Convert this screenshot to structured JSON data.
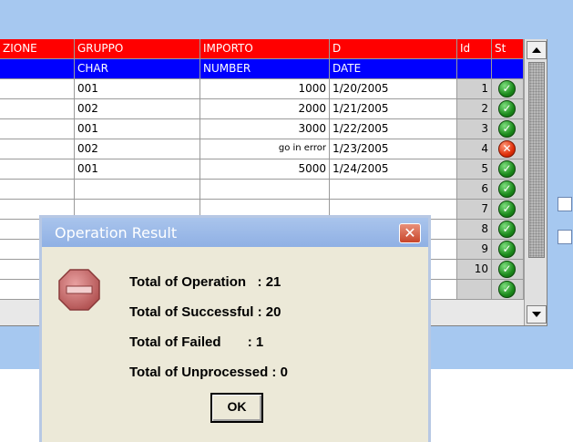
{
  "table": {
    "headers": [
      "ZIONE",
      "GRUPPO",
      "IMPORTO",
      "D",
      "Id",
      "St"
    ],
    "types": [
      "",
      "CHAR",
      "NUMBER",
      "DATE",
      "",
      ""
    ],
    "rows": [
      {
        "gruppo": "001",
        "importo": "1000",
        "date": "1/20/2005",
        "id": "1",
        "status": "success"
      },
      {
        "gruppo": "002",
        "importo": "2000",
        "date": "1/21/2005",
        "id": "2",
        "status": "success"
      },
      {
        "gruppo": "001",
        "importo": "3000",
        "date": "1/22/2005",
        "id": "3",
        "status": "success"
      },
      {
        "gruppo": "002",
        "importo": "go in error",
        "date": "1/23/2005",
        "id": "4",
        "status": "error"
      },
      {
        "gruppo": "001",
        "importo": "5000",
        "date": "1/24/2005",
        "id": "5",
        "status": "success"
      },
      {
        "gruppo": "",
        "importo": "",
        "date": "",
        "id": "6",
        "status": "success"
      },
      {
        "gruppo": "",
        "importo": "",
        "date": "",
        "id": "7",
        "status": "success"
      },
      {
        "gruppo": "",
        "importo": "",
        "date": "",
        "id": "8",
        "status": "success"
      },
      {
        "gruppo": "",
        "importo": "",
        "date": "",
        "id": "9",
        "status": "success"
      },
      {
        "gruppo": "",
        "importo": "",
        "date": "",
        "id": "10",
        "status": "success"
      },
      {
        "gruppo": "",
        "importo": "",
        "date": "",
        "id": "",
        "status": "success"
      }
    ]
  },
  "status_icons": {
    "success": "check-circle-icon",
    "error": "x-circle-icon"
  },
  "dialog": {
    "title": "Operation Result",
    "close_glyph": "✕",
    "icon": "stop-sign-icon",
    "lines": [
      "Total of Operation   : 21",
      "Total of Successful : 20",
      "Total of Failed       : 1",
      "Total of Unprocessed : 0"
    ],
    "ok_label": "OK"
  },
  "colors": {
    "header_bg": "#ff0000",
    "type_bg": "#0000ff",
    "window_bg": "#a6c8f0",
    "dialog_bg": "#ece9d8",
    "title_bar": "#9ab8e8"
  }
}
